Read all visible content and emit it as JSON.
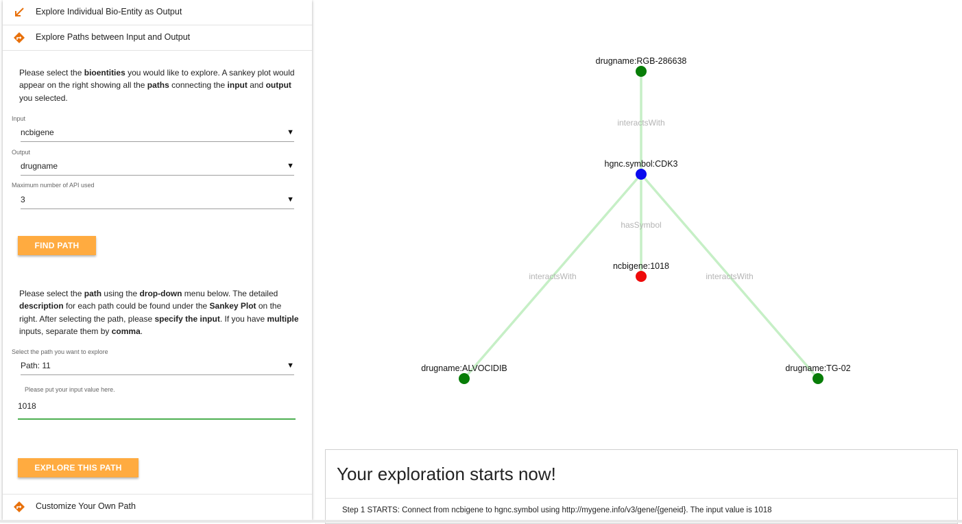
{
  "left_panel": {
    "nav": {
      "bio_entity_label": "Explore Individual Bio-Entity as Output",
      "paths_label": "Explore Paths between Input and Output",
      "customize_label": "Customize Your Own Path"
    },
    "intro_text": [
      {
        "t": "Please select the ",
        "b": false
      },
      {
        "t": "bioentities",
        "b": true
      },
      {
        "t": " you would like to explore. A sankey plot would appear on the right showing all the ",
        "b": false
      },
      {
        "t": "paths",
        "b": true
      },
      {
        "t": " connecting the ",
        "b": false
      },
      {
        "t": "input",
        "b": true
      },
      {
        "t": " and ",
        "b": false
      },
      {
        "t": "output",
        "b": true
      },
      {
        "t": " you selected.",
        "b": false
      }
    ],
    "input": {
      "label": "Input",
      "value": "ncbigene"
    },
    "output": {
      "label": "Output",
      "value": "drugname"
    },
    "max_api": {
      "label": "Maximum number of API used",
      "value": "3"
    },
    "find_path_button": "FIND PATH",
    "path_text": [
      {
        "t": "Please select the ",
        "b": false
      },
      {
        "t": "path",
        "b": true
      },
      {
        "t": " using the ",
        "b": false
      },
      {
        "t": "drop-down",
        "b": true
      },
      {
        "t": " menu below. The detailed ",
        "b": false
      },
      {
        "t": "description",
        "b": true
      },
      {
        "t": " for each path could be found under the ",
        "b": false
      },
      {
        "t": "Sankey Plot",
        "b": true
      },
      {
        "t": " on the right. After selecting the path, please ",
        "b": false
      },
      {
        "t": "specify the input",
        "b": true
      },
      {
        "t": ". If you have ",
        "b": false
      },
      {
        "t": "multiple",
        "b": true
      },
      {
        "t": " inputs, separate them by ",
        "b": false
      },
      {
        "t": "comma",
        "b": true
      },
      {
        "t": ".",
        "b": false
      }
    ],
    "path_select": {
      "label": "Select the path you want to explore",
      "value": "Path: 11"
    },
    "input_value": {
      "label": "Please put your input value here.",
      "value": "1018"
    },
    "explore_button": "EXPLORE THIS PATH",
    "arrow_glyph": "▼"
  },
  "graph": {
    "nodes": [
      {
        "id": "drug_rgb",
        "label": "drugname:RGB-286638",
        "color": "#077d07"
      },
      {
        "id": "cdk3",
        "label": "hgnc.symbol:CDK3",
        "color": "#0a0aee"
      },
      {
        "id": "ncbi",
        "label": "ncbigene:1018",
        "color": "#ee0a0a"
      },
      {
        "id": "alvo",
        "label": "drugname:ALVOCIDIB",
        "color": "#077d07"
      },
      {
        "id": "tg02",
        "label": "drugname:TG-02",
        "color": "#077d07"
      }
    ],
    "edges": [
      {
        "from": "cdk3",
        "to": "drug_rgb",
        "label": "interactsWith"
      },
      {
        "from": "cdk3",
        "to": "ncbi",
        "label": "hasSymbol"
      },
      {
        "from": "cdk3",
        "to": "alvo",
        "label": "interactsWith"
      },
      {
        "from": "cdk3",
        "to": "tg02",
        "label": "interactsWith"
      }
    ],
    "edge_color": "#c6efc6",
    "edge_label_color": "#b4b4b4"
  },
  "exploration": {
    "title": "Your exploration starts now!",
    "step": "Step 1 STARTS: Connect from ncbigene to hgnc.symbol using http://mygene.info/v3/gene/{geneid}. The input value is 1018"
  },
  "colors": {
    "accent": "#ffab40",
    "icon_orange": "#e8700a",
    "input_underline": "#4caf50"
  }
}
